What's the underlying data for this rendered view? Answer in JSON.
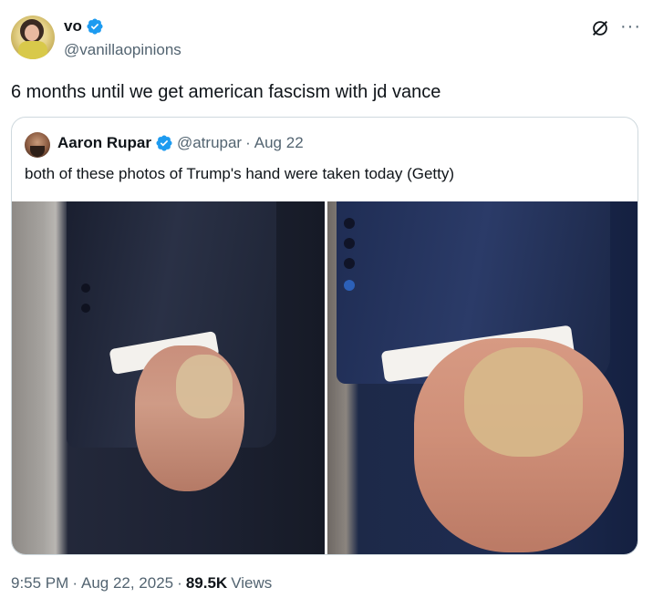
{
  "author": {
    "display_name": "vo",
    "handle": "@vanillaopinions",
    "verified": true
  },
  "tweet": {
    "text": "6 months until we get american fascism with jd vance"
  },
  "quoted_tweet": {
    "display_name": "Aaron Rupar",
    "handle": "@atrupar",
    "separator": "·",
    "date": "Aug 22",
    "verified": true,
    "text": "both of these photos of Trump's hand were taken today (Getty)",
    "photos": [
      {
        "icon": "photo-left-hand"
      },
      {
        "icon": "photo-right-hand"
      }
    ]
  },
  "meta": {
    "time": "9:55 PM",
    "separator1": "·",
    "date": "Aug 22, 2025",
    "separator2": "·",
    "views_count": "89.5K",
    "views_label": "Views"
  },
  "colors": {
    "verified": "#1d9bf0",
    "text": "#0f1419",
    "secondary": "#536471",
    "border": "#cfd9de"
  },
  "icons": {
    "verified": "verified-badge-icon",
    "grok": "grok-icon",
    "more": "more-options-icon"
  }
}
